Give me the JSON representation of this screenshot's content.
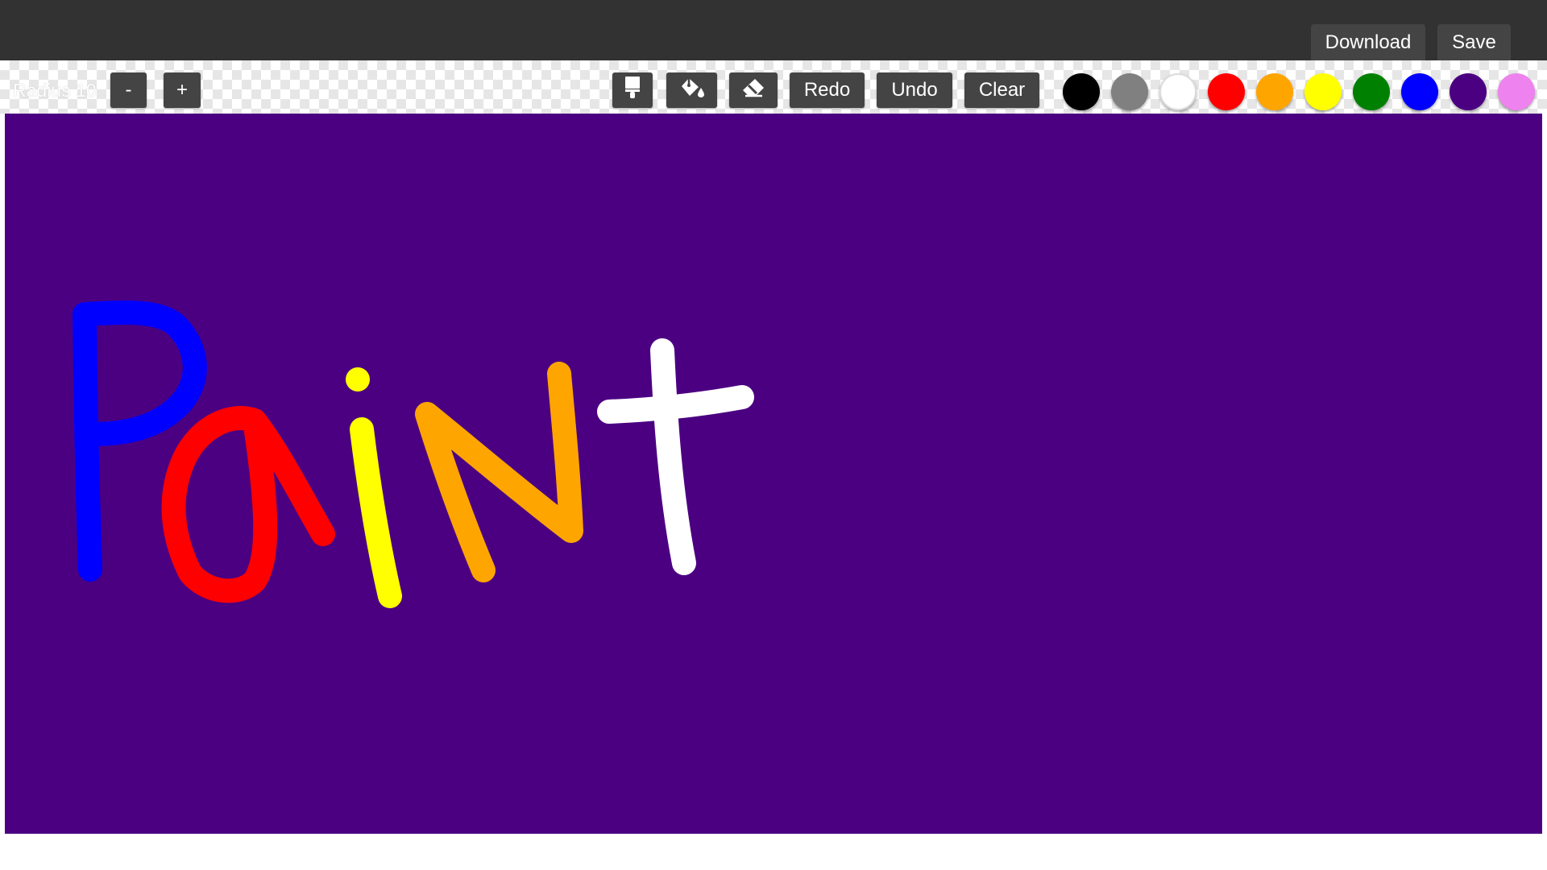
{
  "header": {
    "download_label": "Download",
    "save_label": "Save"
  },
  "toolbar": {
    "radius_label": "Radius 10",
    "decrease_label": "-",
    "increase_label": "+",
    "tools": [
      {
        "name": "brush",
        "icon": "paint-brush-icon"
      },
      {
        "name": "fill",
        "icon": "paint-bucket-icon"
      },
      {
        "name": "eraser",
        "icon": "eraser-icon"
      }
    ],
    "redo_label": "Redo",
    "undo_label": "Undo",
    "clear_label": "Clear"
  },
  "palette": [
    {
      "name": "black",
      "color": "#000000"
    },
    {
      "name": "gray",
      "color": "#808080"
    },
    {
      "name": "white",
      "color": "#ffffff"
    },
    {
      "name": "red",
      "color": "#ff0000"
    },
    {
      "name": "orange",
      "color": "#ffa500"
    },
    {
      "name": "yellow",
      "color": "#ffff00"
    },
    {
      "name": "green",
      "color": "#008000"
    },
    {
      "name": "blue",
      "color": "#0000ff"
    },
    {
      "name": "indigo",
      "color": "#4b0082"
    },
    {
      "name": "violet",
      "color": "#ee82ee"
    }
  ],
  "canvas": {
    "background": "#4b0082",
    "handwritten_text": "Paint"
  }
}
